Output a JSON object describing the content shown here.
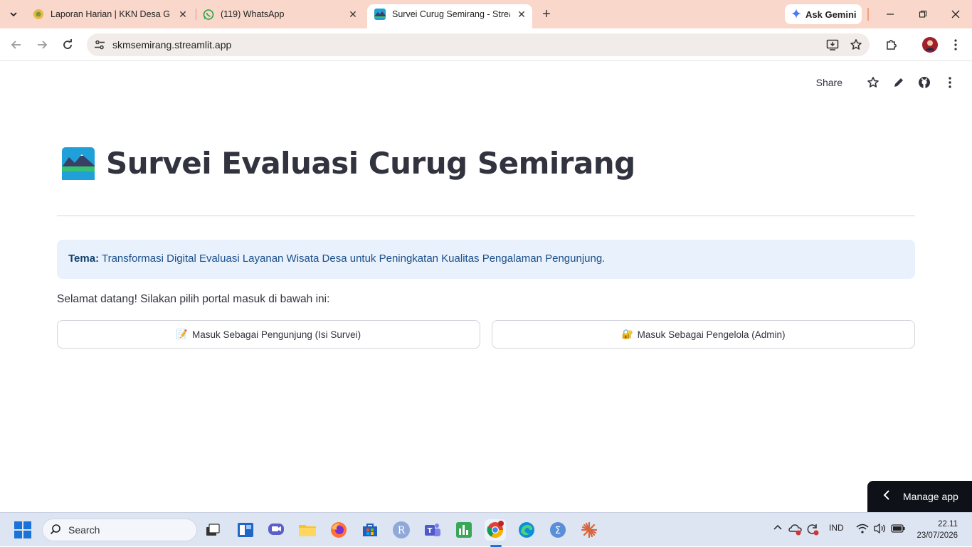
{
  "browser": {
    "tabs": [
      {
        "title": "Laporan Harian | KKN Desa Gog",
        "favicon": "kkn-logo-icon"
      },
      {
        "title": "(119) WhatsApp",
        "favicon": "whatsapp-icon"
      },
      {
        "title": "Survei Curug Semirang - Stream",
        "favicon": "streamlit-landscape-icon",
        "active": true
      }
    ],
    "ask_gemini": "Ask Gemini",
    "url": "skmsemirang.streamlit.app"
  },
  "streamlit_header": {
    "share_label": "Share"
  },
  "main": {
    "title": "Survei Evaluasi Curug Semirang",
    "info_label": "Tema:",
    "info_text": "Transformasi Digital Evaluasi Layanan Wisata Desa untuk Peningkatan Kualitas Pengalaman Pengunjung.",
    "welcome": "Selamat datang! Silakan pilih portal masuk di bawah ini:",
    "buttons": [
      {
        "emoji": "📝",
        "label": "Masuk Sebagai Pengunjung (Isi Survei)"
      },
      {
        "emoji": "🔐",
        "label": "Masuk Sebagai Pengelola (Admin)"
      }
    ],
    "manage_app": "Manage app"
  },
  "taskbar": {
    "search_placeholder": "Search",
    "language": "IND",
    "time": "22.11",
    "date": "23/07/2026"
  },
  "colors": {
    "tabbar": "#f9d8cb",
    "info_bg": "#e8f1fc",
    "info_text": "#1b4f8a",
    "manage_bg": "#0e1117"
  }
}
